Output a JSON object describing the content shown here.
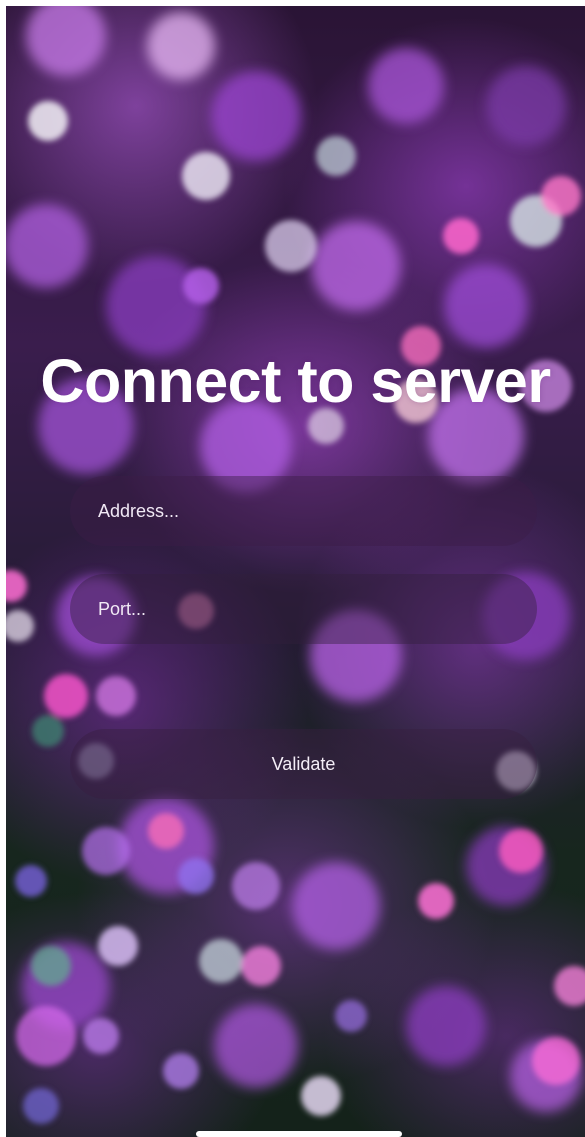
{
  "screen": {
    "title": "Connect to server",
    "background": "purple-bokeh-lights"
  },
  "form": {
    "address": {
      "value": "",
      "placeholder": "Address..."
    },
    "port": {
      "value": "",
      "placeholder": "Port..."
    },
    "validate_label": "Validate"
  },
  "colors": {
    "title_text": "#ffffff",
    "field_text": "#f4eef7",
    "field_background": "#3c1c46",
    "accent_purple": "#b964eb"
  },
  "icons": {
    "home_indicator": "home-indicator-bar"
  }
}
